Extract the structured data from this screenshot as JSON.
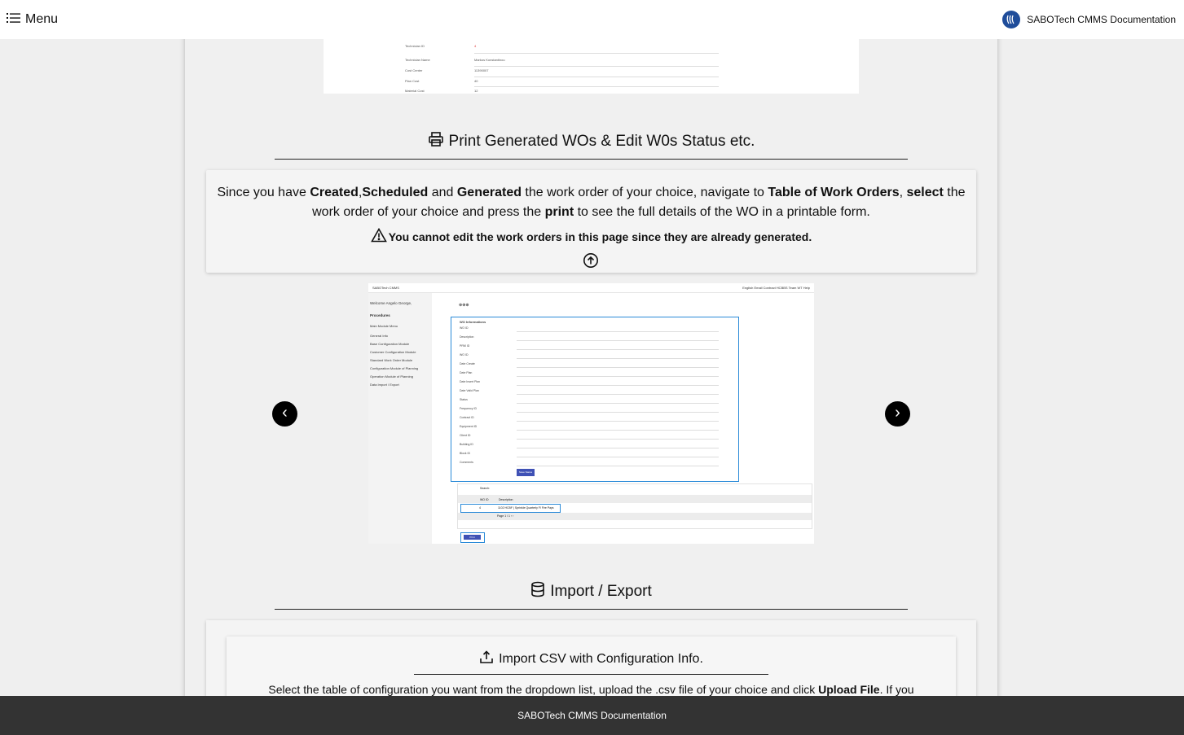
{
  "topbar": {
    "menu_label": "Menu",
    "brand_title": "SABOTech CMMS Documentation"
  },
  "top_screenshot": {
    "rows": [
      "Technician ID",
      "Technician Name",
      "Cost Center",
      "Plan Cost",
      "Material Cost"
    ],
    "values": [
      "4",
      "Markos Konstantinou",
      "11390007",
      "40",
      "12"
    ]
  },
  "section_print": {
    "title": "Print Generated WOs & Edit W0s Status etc.",
    "text_1": "Since you have ",
    "b1": "Created",
    "s1": ",",
    "b2": "Scheduled",
    "text_2": " and ",
    "b3": "Generated",
    "text_3": " the work order of your choice, navigate to ",
    "b4": "Table of Work Orders",
    "text_4": ", ",
    "b5": "select",
    "text_5": " the work order of your choice and press the ",
    "b6": "print",
    "text_6": " to see the full details of the WO in a printable form.",
    "warning": "You cannot edit the work orders in this page since they are already generated."
  },
  "carousel": {
    "prev_label": "‹",
    "next_label": "›",
    "mini": {
      "app_name": "SABOTech CMMS",
      "top_items": "English  Email  Contract  HCBBS  Team  WT  Help",
      "welcome": "Welcome Angelo George,",
      "procedures": "Procedures",
      "main_menu": "Main Module Menu",
      "side_items": [
        "General Info",
        "Base Configuration Module",
        "Customer Configuration Module",
        "Standard Work Order Module",
        "Configuration Module of Planning",
        "Operation Module of Planning",
        "Data Import / Export"
      ],
      "form_title": "WO Informations",
      "form_rows": [
        "WO ID",
        "Description",
        "PRM ID",
        "WO ID",
        "Date Create",
        "Date Plan",
        "Date Insert Plan",
        "Date Valid Plan",
        "Status",
        "Frequency ID",
        "Contract ID",
        "Equipment ID",
        "Client ID",
        "Building ID",
        "Block ID",
        "Comments"
      ],
      "save_btn": "Save Status",
      "search_label": "Search:",
      "table_header_1": "WO ID",
      "table_header_2": "Description",
      "table_row_id": "4",
      "table_row_desc": "1102 HCBF | Sprinkle Quarterly Fl Fire Pays",
      "pager": "Page 1 / 1  ‹ ›",
      "print_btn": "Print"
    }
  },
  "section_import": {
    "title": "Import / Export",
    "sub_title": "Import CSV with Configuration Info.",
    "text_1": "Select the table of configuration you want from the dropdown list, upload the .csv file of your choice and click ",
    "b1": "Upload File",
    "text_2": ". If you"
  },
  "footer": {
    "text": "SABOTech CMMS Documentation"
  }
}
